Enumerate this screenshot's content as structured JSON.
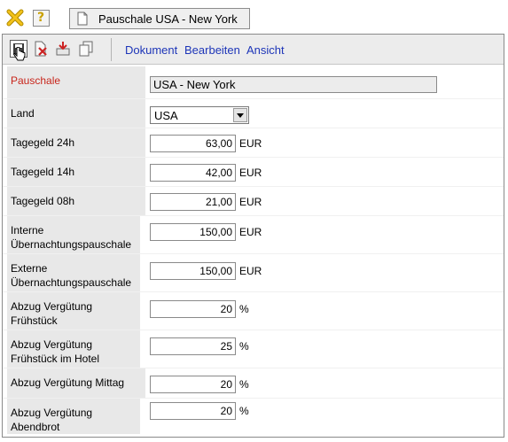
{
  "window": {
    "tab_title": "Pauschale USA - New York",
    "close_icon": "close-x-icon",
    "help_icon": "help-question-icon",
    "help_glyph": "?"
  },
  "toolbar": {
    "icons": [
      "save-icon",
      "delete-icon",
      "export-icon",
      "copy-icon"
    ],
    "menus": [
      "Dokument",
      "Bearbeiten",
      "Ansicht"
    ]
  },
  "form": {
    "pauschale_label": "Pauschale",
    "pauschale_value": "USA - New York",
    "land_label": "Land",
    "land_value": "USA",
    "fields": [
      {
        "label": "Tagegeld 24h",
        "value": "63,00",
        "unit": "EUR"
      },
      {
        "label": "Tagegeld 14h",
        "value": "42,00",
        "unit": "EUR"
      },
      {
        "label": "Tagegeld 08h",
        "value": "21,00",
        "unit": "EUR"
      },
      {
        "label": "Interne Übernachtungspauschale",
        "value": "150,00",
        "unit": "EUR"
      },
      {
        "label": "Externe Übernachtungspauschale",
        "value": "150,00",
        "unit": "EUR"
      },
      {
        "label": "Abzug Vergütung Frühstück",
        "value": "20",
        "unit": "%"
      },
      {
        "label": "Abzug Vergütung Frühstück im Hotel",
        "value": "25",
        "unit": "%"
      },
      {
        "label": "Abzug Vergütung Mittag",
        "value": "20",
        "unit": "%"
      },
      {
        "label": "Abzug Vergütung Abendbrot",
        "value": "20",
        "unit": "%"
      }
    ]
  },
  "colors": {
    "accent_label": "#c8261c",
    "menu_link": "#1d35b8",
    "label_bg": "#e8e8e8"
  }
}
